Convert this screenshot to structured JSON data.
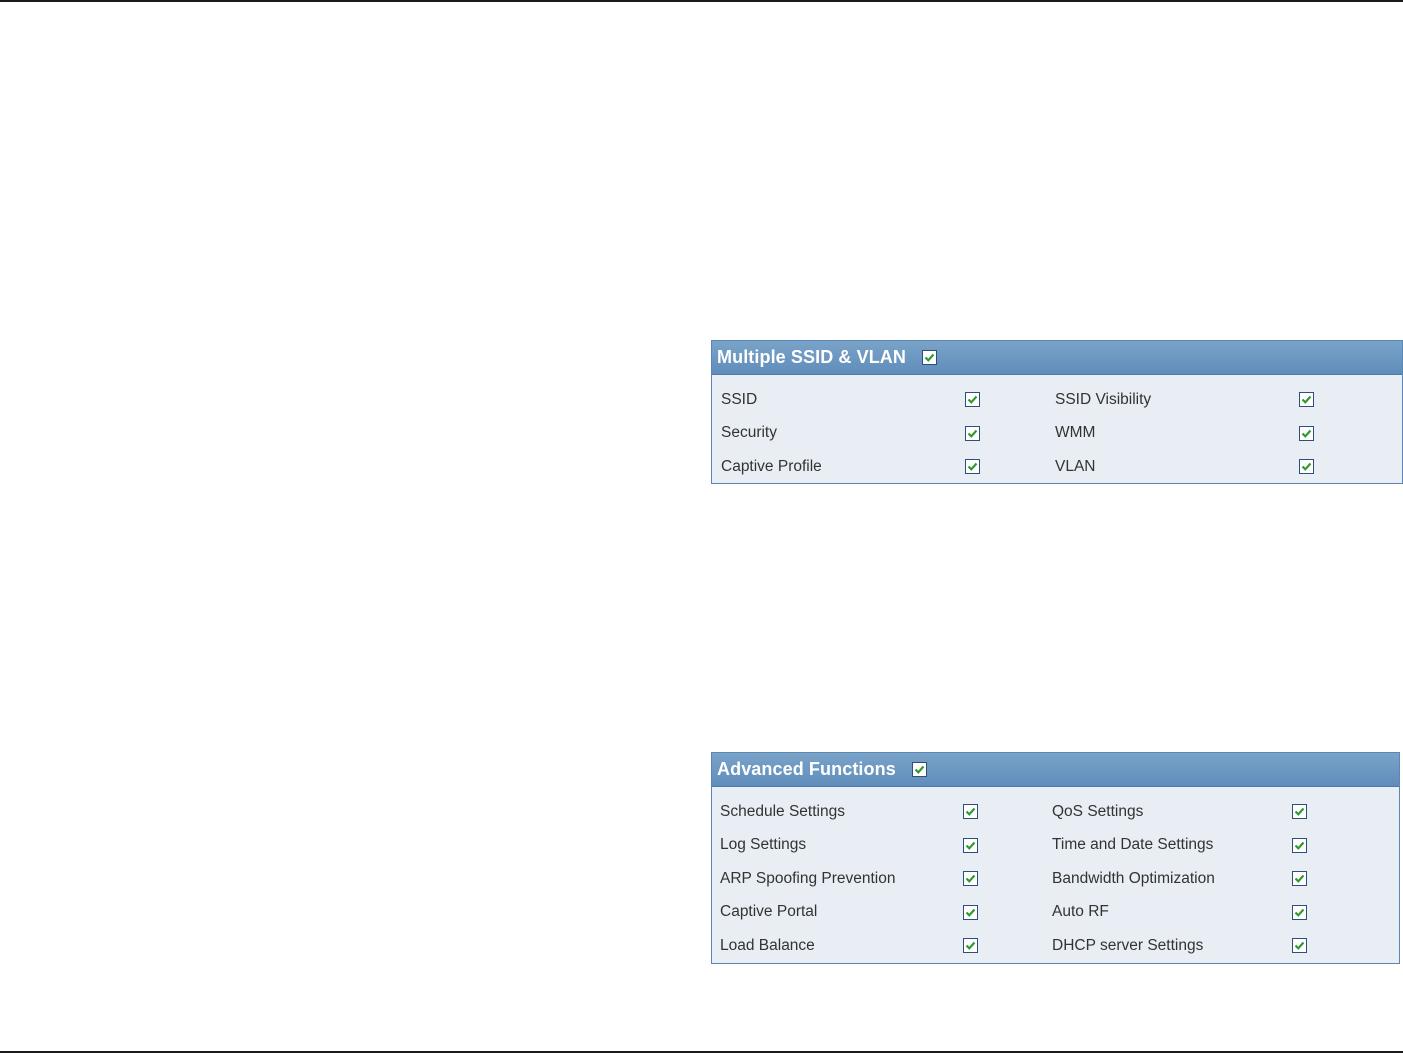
{
  "panels": {
    "ssid": {
      "title": "Multiple SSID & VLAN",
      "checked": true,
      "rows": [
        {
          "left": {
            "label": "SSID",
            "checked": true
          },
          "right": {
            "label": "SSID Visibility",
            "checked": true
          }
        },
        {
          "left": {
            "label": "Security",
            "checked": true
          },
          "right": {
            "label": "WMM",
            "checked": true
          }
        },
        {
          "left": {
            "label": "Captive Profile",
            "checked": true
          },
          "right": {
            "label": "VLAN",
            "checked": true
          }
        }
      ]
    },
    "advanced": {
      "title": "Advanced Functions",
      "checked": true,
      "rows": [
        {
          "left": {
            "label": "Schedule Settings",
            "checked": true
          },
          "right": {
            "label": "QoS Settings",
            "checked": true
          }
        },
        {
          "left": {
            "label": "Log Settings",
            "checked": true
          },
          "right": {
            "label": "Time and Date Settings",
            "checked": true
          }
        },
        {
          "left": {
            "label": "ARP Spoofing Prevention",
            "checked": true
          },
          "right": {
            "label": "Bandwidth Optimization",
            "checked": true
          }
        },
        {
          "left": {
            "label": "Captive Portal",
            "checked": true
          },
          "right": {
            "label": "Auto RF",
            "checked": true
          }
        },
        {
          "left": {
            "label": "Load Balance",
            "checked": true
          },
          "right": {
            "label": "DHCP server Settings",
            "checked": true
          }
        }
      ]
    }
  },
  "icons": {
    "checkbox": "checkmark-icon"
  },
  "colors": {
    "header": "#6a96c2",
    "panel_bg": "#e8eef3",
    "check": "#2f9a2f"
  }
}
